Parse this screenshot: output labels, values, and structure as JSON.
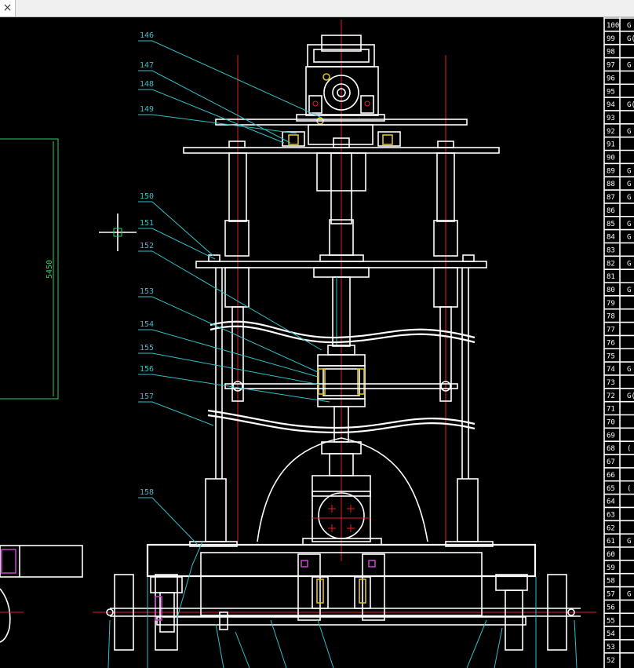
{
  "toolbar": {
    "close_glyph": "×"
  },
  "callouts": [
    "146",
    "147",
    "148",
    "149",
    "150",
    "151",
    "152",
    "153",
    "154",
    "155",
    "156",
    "157",
    "158"
  ],
  "dimension": "5450",
  "parts_table": {
    "numbers": [
      "100",
      "99",
      "98",
      "97",
      "96",
      "95",
      "94",
      "93",
      "92",
      "91",
      "90",
      "89",
      "88",
      "87",
      "86",
      "85",
      "84",
      "83",
      "82",
      "81",
      "80",
      "79",
      "78",
      "77",
      "76",
      "75",
      "74",
      "73",
      "72",
      "71",
      "70",
      "69",
      "68",
      "67",
      "66",
      "65",
      "64",
      "63",
      "62",
      "61",
      "60",
      "59",
      "58",
      "57",
      "56",
      "55",
      "54",
      "53",
      "52"
    ],
    "codes": [
      "G",
      "G(",
      "",
      "G",
      "",
      "",
      "G(",
      "",
      "G",
      "",
      "",
      "G",
      "G",
      "G",
      "",
      "G",
      "G",
      "",
      "G",
      "",
      "G",
      "",
      "",
      "",
      "",
      "",
      "G",
      "",
      "G(",
      "",
      "",
      "",
      "(",
      "",
      "",
      "(",
      "",
      "",
      "",
      "G",
      "",
      "",
      "",
      "G",
      "",
      "",
      "",
      "",
      ""
    ]
  },
  "colors": {
    "outline": "#ffffff",
    "centerline": "#e0202a",
    "leader": "#30c0c8",
    "dimension": "#2fd06a"
  }
}
